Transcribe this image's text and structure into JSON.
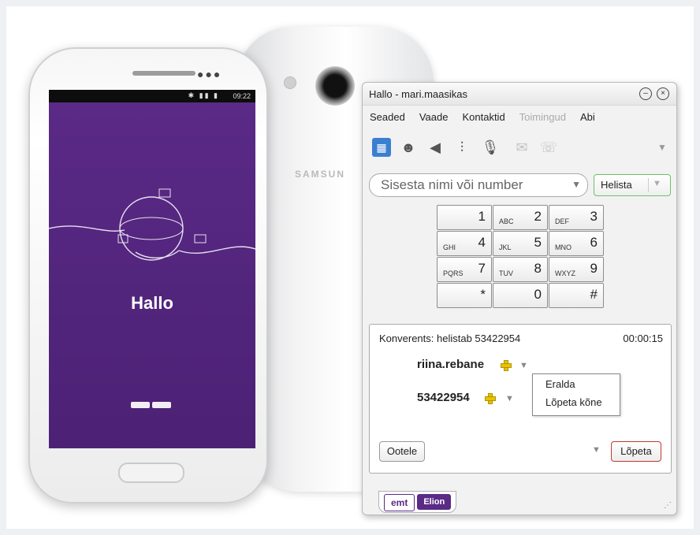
{
  "phone_screen": {
    "status_time": "09:22",
    "app_name": "Hallo",
    "back_brand": "SAMSUN"
  },
  "window": {
    "title": "Hallo - mari.maasikas",
    "menu": [
      {
        "label": "Seaded",
        "enabled": true
      },
      {
        "label": "Vaade",
        "enabled": true
      },
      {
        "label": "Kontaktid",
        "enabled": true
      },
      {
        "label": "Toimingud",
        "enabled": false
      },
      {
        "label": "Abi",
        "enabled": true
      }
    ],
    "toolbar_icons": [
      "dialpad-icon",
      "contacts-icon",
      "speaker-icon",
      "mixer-icon",
      "microphone-icon",
      "mail-icon",
      "call-forward-icon"
    ],
    "search": {
      "placeholder": "Sisesta nimi või number"
    },
    "call_button": "Helista",
    "dialpad": [
      {
        "letters": "",
        "digit": "1"
      },
      {
        "letters": "ABC",
        "digit": "2"
      },
      {
        "letters": "DEF",
        "digit": "3"
      },
      {
        "letters": "GHI",
        "digit": "4"
      },
      {
        "letters": "JKL",
        "digit": "5"
      },
      {
        "letters": "MNO",
        "digit": "6"
      },
      {
        "letters": "PQRS",
        "digit": "7"
      },
      {
        "letters": "TUV",
        "digit": "8"
      },
      {
        "letters": "WXYZ",
        "digit": "9"
      },
      {
        "letters": "",
        "digit": "*"
      },
      {
        "letters": "",
        "digit": "0"
      },
      {
        "letters": "",
        "digit": "#"
      }
    ],
    "call": {
      "status": "Konverents: helistab 53422954",
      "timer": "00:00:15",
      "participants": [
        "riina.rebane",
        "53422954"
      ],
      "context_menu": [
        "Eralda",
        "Lõpeta kõne"
      ],
      "hold_button": "Ootele",
      "end_button": "Lõpeta"
    },
    "brands": [
      "emt",
      "Elion"
    ],
    "colors": {
      "accent_purple": "#5a2a86",
      "call_green": "#6bc06b",
      "end_red": "#c0392b"
    }
  }
}
